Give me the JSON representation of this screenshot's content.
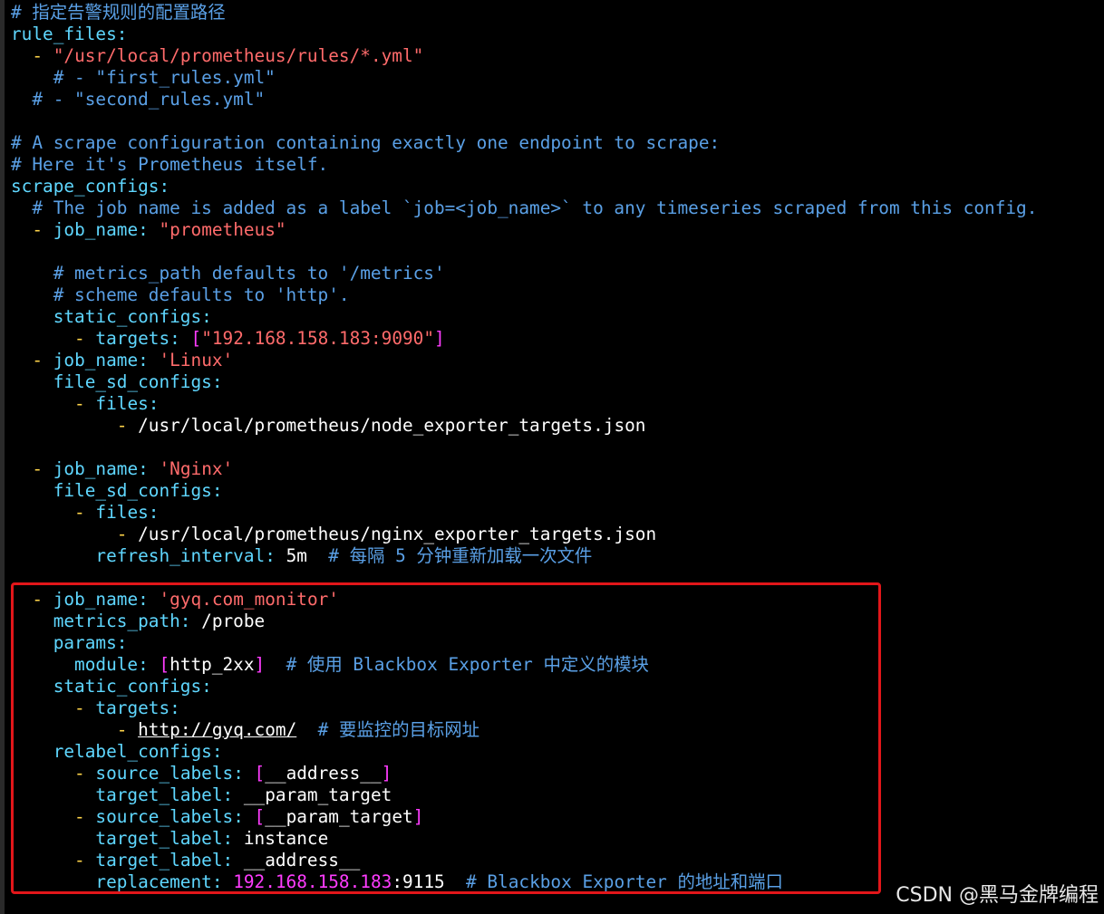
{
  "colors": {
    "background": "#000000",
    "comment": "#5aa0e6",
    "key": "#5fd7ff",
    "string": "#ff6b6b",
    "dash": "#ffd54a",
    "magenta": "#ff3cff",
    "highlight_border": "#e2161a"
  },
  "lines": [
    {
      "segs": [
        {
          "t": "# 指定告警规则的配置路径",
          "c": "c"
        }
      ]
    },
    {
      "segs": [
        {
          "t": "rule_files",
          "c": "k"
        },
        {
          "t": ":",
          "c": "k"
        }
      ]
    },
    {
      "segs": [
        {
          "t": "  ",
          "c": "w"
        },
        {
          "t": "-",
          "c": "d"
        },
        {
          "t": " ",
          "c": "w"
        },
        {
          "t": "\"/usr/local/prometheus/rules/*.yml\"",
          "c": "s"
        }
      ]
    },
    {
      "segs": [
        {
          "t": "    # - \"first_rules.yml\"",
          "c": "c"
        }
      ]
    },
    {
      "segs": [
        {
          "t": "  # - \"second_rules.yml\"",
          "c": "c"
        }
      ]
    },
    {
      "segs": [
        {
          "t": "",
          "c": "w"
        }
      ]
    },
    {
      "segs": [
        {
          "t": "# A scrape configuration containing exactly one endpoint to scrape:",
          "c": "c"
        }
      ]
    },
    {
      "segs": [
        {
          "t": "# Here it's Prometheus itself.",
          "c": "c"
        }
      ]
    },
    {
      "segs": [
        {
          "t": "scrape_configs",
          "c": "k"
        },
        {
          "t": ":",
          "c": "k"
        }
      ]
    },
    {
      "segs": [
        {
          "t": "  # The job name is added as a label `job=<job_name>` to any timeseries scraped from this config.",
          "c": "c"
        }
      ]
    },
    {
      "segs": [
        {
          "t": "  ",
          "c": "w"
        },
        {
          "t": "-",
          "c": "d"
        },
        {
          "t": " ",
          "c": "w"
        },
        {
          "t": "job_name",
          "c": "k"
        },
        {
          "t": ": ",
          "c": "k"
        },
        {
          "t": "\"prometheus\"",
          "c": "s"
        }
      ]
    },
    {
      "segs": [
        {
          "t": "",
          "c": "w"
        }
      ]
    },
    {
      "segs": [
        {
          "t": "    # metrics_path defaults to '/metrics'",
          "c": "c"
        }
      ]
    },
    {
      "segs": [
        {
          "t": "    # scheme defaults to 'http'.",
          "c": "c"
        }
      ]
    },
    {
      "segs": [
        {
          "t": "    ",
          "c": "w"
        },
        {
          "t": "static_configs",
          "c": "k"
        },
        {
          "t": ":",
          "c": "k"
        }
      ]
    },
    {
      "segs": [
        {
          "t": "      ",
          "c": "w"
        },
        {
          "t": "-",
          "c": "d"
        },
        {
          "t": " ",
          "c": "w"
        },
        {
          "t": "targets",
          "c": "k"
        },
        {
          "t": ": ",
          "c": "k"
        },
        {
          "t": "[",
          "c": "p"
        },
        {
          "t": "\"192.168.158.183:9090\"",
          "c": "s"
        },
        {
          "t": "]",
          "c": "p"
        }
      ]
    },
    {
      "segs": [
        {
          "t": "  ",
          "c": "w"
        },
        {
          "t": "-",
          "c": "d"
        },
        {
          "t": " ",
          "c": "w"
        },
        {
          "t": "job_name",
          "c": "k"
        },
        {
          "t": ": ",
          "c": "k"
        },
        {
          "t": "'Linux'",
          "c": "s"
        }
      ]
    },
    {
      "segs": [
        {
          "t": "    ",
          "c": "w"
        },
        {
          "t": "file_sd_configs",
          "c": "k"
        },
        {
          "t": ":",
          "c": "k"
        }
      ]
    },
    {
      "segs": [
        {
          "t": "      ",
          "c": "w"
        },
        {
          "t": "-",
          "c": "d"
        },
        {
          "t": " ",
          "c": "w"
        },
        {
          "t": "files",
          "c": "k"
        },
        {
          "t": ":",
          "c": "k"
        }
      ]
    },
    {
      "segs": [
        {
          "t": "          ",
          "c": "w"
        },
        {
          "t": "-",
          "c": "d"
        },
        {
          "t": " /usr/local/prometheus/node_exporter_targets.json",
          "c": "w"
        }
      ]
    },
    {
      "segs": [
        {
          "t": "",
          "c": "w"
        }
      ]
    },
    {
      "segs": [
        {
          "t": "  ",
          "c": "w"
        },
        {
          "t": "-",
          "c": "d"
        },
        {
          "t": " ",
          "c": "w"
        },
        {
          "t": "job_name",
          "c": "k"
        },
        {
          "t": ": ",
          "c": "k"
        },
        {
          "t": "'Nginx'",
          "c": "s"
        }
      ]
    },
    {
      "segs": [
        {
          "t": "    ",
          "c": "w"
        },
        {
          "t": "file_sd_configs",
          "c": "k"
        },
        {
          "t": ":",
          "c": "k"
        }
      ]
    },
    {
      "segs": [
        {
          "t": "      ",
          "c": "w"
        },
        {
          "t": "-",
          "c": "d"
        },
        {
          "t": " ",
          "c": "w"
        },
        {
          "t": "files",
          "c": "k"
        },
        {
          "t": ":",
          "c": "k"
        }
      ]
    },
    {
      "segs": [
        {
          "t": "          ",
          "c": "w"
        },
        {
          "t": "-",
          "c": "d"
        },
        {
          "t": " /usr/local/prometheus/nginx_exporter_targets.json",
          "c": "w"
        }
      ]
    },
    {
      "segs": [
        {
          "t": "        ",
          "c": "w"
        },
        {
          "t": "refresh_interval",
          "c": "k"
        },
        {
          "t": ": ",
          "c": "k"
        },
        {
          "t": "5m",
          "c": "w"
        },
        {
          "t": "  # 每隔 5 分钟重新加载一次文件",
          "c": "c"
        }
      ]
    },
    {
      "segs": [
        {
          "t": "",
          "c": "w"
        }
      ]
    },
    {
      "segs": [
        {
          "t": "  ",
          "c": "w"
        },
        {
          "t": "-",
          "c": "d"
        },
        {
          "t": " ",
          "c": "w"
        },
        {
          "t": "job_name",
          "c": "k"
        },
        {
          "t": ": ",
          "c": "k"
        },
        {
          "t": "'gyq.com_monitor'",
          "c": "s"
        }
      ]
    },
    {
      "segs": [
        {
          "t": "    ",
          "c": "w"
        },
        {
          "t": "metrics_path",
          "c": "k"
        },
        {
          "t": ": ",
          "c": "k"
        },
        {
          "t": "/probe",
          "c": "w"
        }
      ]
    },
    {
      "segs": [
        {
          "t": "    ",
          "c": "w"
        },
        {
          "t": "params",
          "c": "k"
        },
        {
          "t": ":",
          "c": "k"
        }
      ]
    },
    {
      "segs": [
        {
          "t": "      ",
          "c": "w"
        },
        {
          "t": "module",
          "c": "k"
        },
        {
          "t": ": ",
          "c": "k"
        },
        {
          "t": "[",
          "c": "p"
        },
        {
          "t": "http_2xx",
          "c": "w"
        },
        {
          "t": "]",
          "c": "p"
        },
        {
          "t": "  # 使用 Blackbox Exporter 中定义的模块",
          "c": "c"
        }
      ]
    },
    {
      "segs": [
        {
          "t": "    ",
          "c": "w"
        },
        {
          "t": "static_configs",
          "c": "k"
        },
        {
          "t": ":",
          "c": "k"
        }
      ]
    },
    {
      "segs": [
        {
          "t": "      ",
          "c": "w"
        },
        {
          "t": "-",
          "c": "d"
        },
        {
          "t": " ",
          "c": "w"
        },
        {
          "t": "targets",
          "c": "k"
        },
        {
          "t": ":",
          "c": "k"
        }
      ]
    },
    {
      "segs": [
        {
          "t": "          ",
          "c": "w"
        },
        {
          "t": "-",
          "c": "d"
        },
        {
          "t": " ",
          "c": "w"
        },
        {
          "t": "http://gyq.com/",
          "c": "u"
        },
        {
          "t": "  # 要监控的目标网址",
          "c": "c"
        }
      ]
    },
    {
      "segs": [
        {
          "t": "    ",
          "c": "w"
        },
        {
          "t": "relabel_configs",
          "c": "k"
        },
        {
          "t": ":",
          "c": "k"
        }
      ]
    },
    {
      "segs": [
        {
          "t": "      ",
          "c": "w"
        },
        {
          "t": "-",
          "c": "d"
        },
        {
          "t": " ",
          "c": "w"
        },
        {
          "t": "source_labels",
          "c": "k"
        },
        {
          "t": ": ",
          "c": "k"
        },
        {
          "t": "[",
          "c": "p"
        },
        {
          "t": "__address__",
          "c": "w"
        },
        {
          "t": "]",
          "c": "p"
        }
      ]
    },
    {
      "segs": [
        {
          "t": "        ",
          "c": "w"
        },
        {
          "t": "target_label",
          "c": "k"
        },
        {
          "t": ": ",
          "c": "k"
        },
        {
          "t": "__param_target",
          "c": "w"
        }
      ]
    },
    {
      "segs": [
        {
          "t": "      ",
          "c": "w"
        },
        {
          "t": "-",
          "c": "d"
        },
        {
          "t": " ",
          "c": "w"
        },
        {
          "t": "source_labels",
          "c": "k"
        },
        {
          "t": ": ",
          "c": "k"
        },
        {
          "t": "[",
          "c": "p"
        },
        {
          "t": "__param_target",
          "c": "w"
        },
        {
          "t": "]",
          "c": "p"
        }
      ]
    },
    {
      "segs": [
        {
          "t": "        ",
          "c": "w"
        },
        {
          "t": "target_label",
          "c": "k"
        },
        {
          "t": ": ",
          "c": "k"
        },
        {
          "t": "instance",
          "c": "w"
        }
      ]
    },
    {
      "segs": [
        {
          "t": "      ",
          "c": "w"
        },
        {
          "t": "-",
          "c": "d"
        },
        {
          "t": " ",
          "c": "w"
        },
        {
          "t": "target_label",
          "c": "k"
        },
        {
          "t": ": ",
          "c": "k"
        },
        {
          "t": "__address__",
          "c": "w"
        }
      ]
    },
    {
      "segs": [
        {
          "t": "        ",
          "c": "w"
        },
        {
          "t": "replacement",
          "c": "k"
        },
        {
          "t": ": ",
          "c": "k"
        },
        {
          "t": "192.168.158.183",
          "c": "p"
        },
        {
          "t": ":9115",
          "c": "w"
        },
        {
          "t": "  # Blackbox Exporter 的地址和端口",
          "c": "c"
        }
      ]
    }
  ],
  "watermark": "CSDN @黑马金牌编程"
}
